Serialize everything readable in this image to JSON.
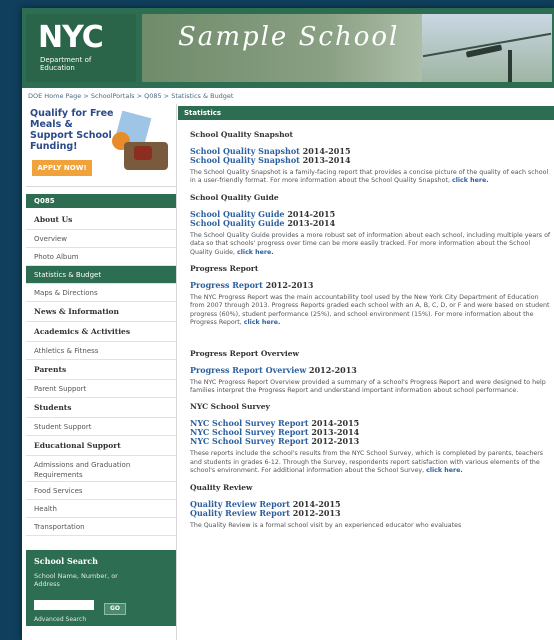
{
  "header": {
    "logo_title": "NYC",
    "logo_subtitle": "Department of Education",
    "banner_title": "Sample School"
  },
  "breadcrumb": "DOE Home Page > SchoolPortals > Q085 > Statistics & Budget",
  "promo": {
    "title": "Qualify for Free Meals & Support School Funding!",
    "button": "APPLY NOW!"
  },
  "sidebar": {
    "school_code": "Q085",
    "items": [
      {
        "label": "About Us",
        "type": "head"
      },
      {
        "label": "Overview",
        "type": "item"
      },
      {
        "label": "Photo Album",
        "type": "item"
      },
      {
        "label": "Statistics & Budget",
        "type": "active"
      },
      {
        "label": "Maps & Directions",
        "type": "item"
      },
      {
        "label": "News & Information",
        "type": "head"
      },
      {
        "label": "Academics & Activities",
        "type": "head"
      },
      {
        "label": "Athletics & Fitness",
        "type": "item"
      },
      {
        "label": "Parents",
        "type": "head"
      },
      {
        "label": "Parent Support",
        "type": "item"
      },
      {
        "label": "Students",
        "type": "head"
      },
      {
        "label": "Student Support",
        "type": "item"
      },
      {
        "label": "Educational Support",
        "type": "head"
      },
      {
        "label": "Admissions and Graduation Requirements",
        "type": "tall"
      },
      {
        "label": "Food Services",
        "type": "item"
      },
      {
        "label": "Health",
        "type": "item"
      },
      {
        "label": "Transportation",
        "type": "item"
      }
    ],
    "search": {
      "title": "School Search",
      "hint": "School Name, Number, or Address",
      "go": "GO",
      "advanced": "Advanced Search"
    }
  },
  "main": {
    "bar_title": "Statistics",
    "sections": [
      {
        "title": "School Quality Snapshot",
        "links": [
          {
            "text": "School Quality Snapshot",
            "year": "2014-2015"
          },
          {
            "text": "School Quality Snapshot",
            "year": "2013-2014"
          }
        ],
        "desc": "The School Quality Snapshot is a family-facing report that provides a concise picture of the quality of each school in a user-friendly format. For more information about the School Quality Snapshot,",
        "more": "click here."
      },
      {
        "title": "School Quality Guide",
        "links": [
          {
            "text": "School Quality Guide",
            "year": "2014-2015"
          },
          {
            "text": "School Quality Guide",
            "year": "2013-2014"
          }
        ],
        "desc": "The School Quality Guide provides a more robust set of information about each school, including multiple years of data so that schools' progress over time can be more easily tracked. For more information about the School Quality Guide,",
        "more": "click here."
      },
      {
        "title": "Progress Report",
        "links": [
          {
            "text": "Progress Report",
            "year": "2012-2013"
          }
        ],
        "desc": "The NYC Progress Report was the main accountability tool used by the New York City Department of Education from 2007 through 2013. Progress Reports graded each school with an A, B, C, D, or F and were based on student progress (60%), student performance (25%), and school environment (15%). For more information about the Progress Report,",
        "more": "click here."
      },
      {
        "title": "Progress Report Overview",
        "links": [
          {
            "text": "Progress Report Overview",
            "year": "2012-2013"
          }
        ],
        "desc": "The NYC Progress Report Overview provided a summary of a school's Progress Report and were designed to help families interpret the Progress Report and understand important information about school performance.",
        "more": ""
      },
      {
        "title": "NYC School Survey",
        "links": [
          {
            "text": "NYC School Survey Report",
            "year": "2014-2015"
          },
          {
            "text": "NYC School Survey Report",
            "year": "2013-2014"
          },
          {
            "text": "NYC School Survey Report",
            "year": "2012-2013"
          }
        ],
        "desc": "These reports include the school's results from the NYC School Survey, which is completed by parents, teachers and students in grades 6-12. Through the Survey, respondents report satisfaction with various elements of the school's environment. For additional information about the School Survey,",
        "more": "click here."
      },
      {
        "title": "Quality Review",
        "links": [
          {
            "text": "Quality Review Report",
            "year": "2014-2015"
          },
          {
            "text": "Quality Review Report",
            "year": "2012-2013"
          }
        ],
        "desc": "The Quality Review is a formal school visit by an experienced educator who evaluates",
        "more": ""
      }
    ]
  }
}
